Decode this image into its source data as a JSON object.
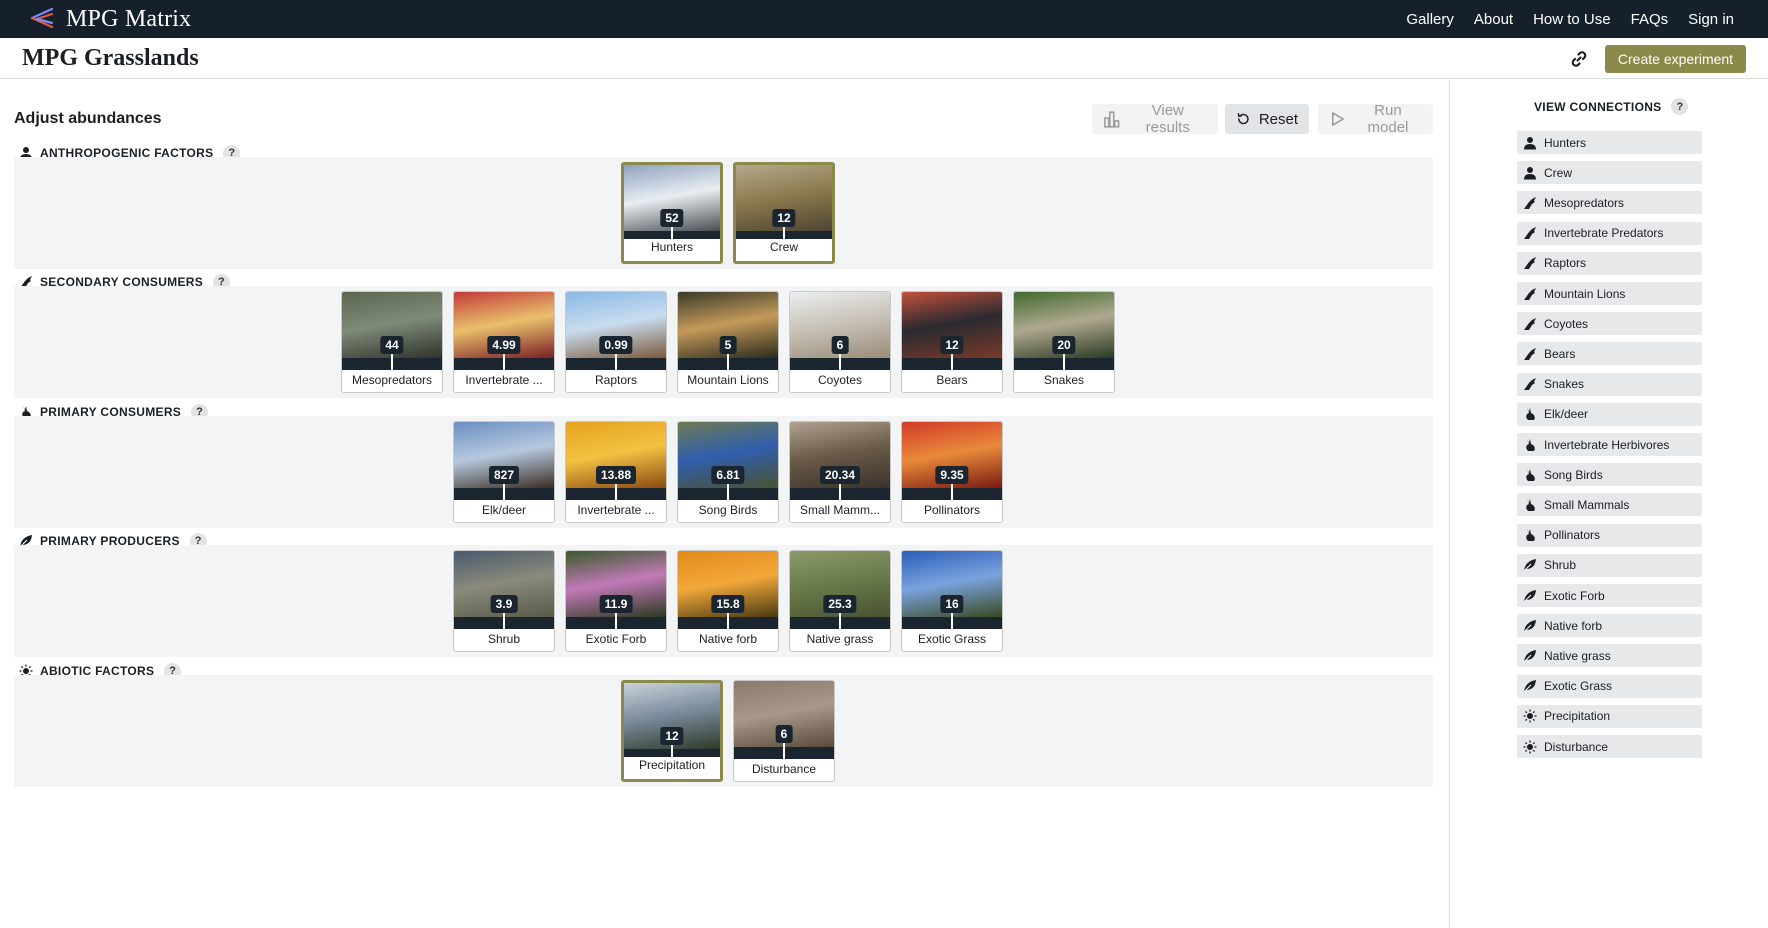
{
  "app": {
    "brand": "MPG Matrix",
    "nav": [
      "Gallery",
      "About",
      "How to Use",
      "FAQs",
      "Sign in"
    ]
  },
  "header": {
    "title": "MPG Grasslands",
    "create_label": "Create experiment",
    "accent": "#8c8a4a"
  },
  "main": {
    "title": "Adjust abundances",
    "buttons": {
      "view_results": "View results",
      "reset": "Reset",
      "run_model": "Run model"
    },
    "sections": [
      {
        "title": "ANTHROPOGENIC FACTORS",
        "icon": "person-icon",
        "tiles": [
          {
            "label": "Hunters",
            "value": "52",
            "selected": true,
            "photo": [
              "#8fa3bf",
              "#e9edf2",
              "#4a4e53"
            ]
          },
          {
            "label": "Crew",
            "value": "12",
            "selected": true,
            "photo": [
              "#b4a98c",
              "#8c7a4e",
              "#4e4433"
            ]
          }
        ]
      },
      {
        "title": "SECONDARY CONSUMERS",
        "icon": "predator-icon",
        "tiles": [
          {
            "label": "Mesopredators",
            "value": "44",
            "selected": false,
            "photo": [
              "#5c6650",
              "#7f8a78",
              "#2e332a"
            ]
          },
          {
            "label": "Invertebrate ...",
            "value": "4.99",
            "selected": false,
            "photo": [
              "#c23a3a",
              "#e9c06b",
              "#7a1e27"
            ]
          },
          {
            "label": "Raptors",
            "value": "0.99",
            "selected": false,
            "photo": [
              "#8ab8e6",
              "#c9dcef",
              "#7a5a3a"
            ]
          },
          {
            "label": "Mountain Lions",
            "value": "5",
            "selected": false,
            "photo": [
              "#3a3a2a",
              "#c49a5a",
              "#2a2a1e"
            ]
          },
          {
            "label": "Coyotes",
            "value": "6",
            "selected": false,
            "photo": [
              "#eceef0",
              "#c8c2b8",
              "#9a8c78"
            ]
          },
          {
            "label": "Bears",
            "value": "12",
            "selected": false,
            "photo": [
              "#c2503a",
              "#2a2a30",
              "#7a3a2a"
            ]
          },
          {
            "label": "Snakes",
            "value": "20",
            "selected": false,
            "photo": [
              "#3f6a2e",
              "#b0a890",
              "#2a3a22"
            ]
          }
        ]
      },
      {
        "title": "PRIMARY CONSUMERS",
        "icon": "rabbit-icon",
        "tiles": [
          {
            "label": "Elk/deer",
            "value": "827",
            "selected": false,
            "photo": [
              "#6c8fc2",
              "#b6c8de",
              "#3a2e22"
            ]
          },
          {
            "label": "Invertebrate ...",
            "value": "13.88",
            "selected": false,
            "photo": [
              "#e6a21e",
              "#f2c243",
              "#8a4a12"
            ]
          },
          {
            "label": "Song Birds",
            "value": "6.81",
            "selected": false,
            "photo": [
              "#6f7a52",
              "#2f5fae",
              "#4a5232"
            ]
          },
          {
            "label": "Small Mamm...",
            "value": "20.34",
            "selected": false,
            "photo": [
              "#b0a292",
              "#6a5a48",
              "#3a322a"
            ]
          },
          {
            "label": "Pollinators",
            "value": "9.35",
            "selected": false,
            "photo": [
              "#d23a2a",
              "#e88a3a",
              "#7a1a14"
            ]
          }
        ]
      },
      {
        "title": "PRIMARY PRODUCERS",
        "icon": "leaf-icon",
        "tiles": [
          {
            "label": "Shrub",
            "value": "3.9",
            "selected": false,
            "photo": [
              "#4a5a6e",
              "#8a8a7a",
              "#5a5a4a"
            ]
          },
          {
            "label": "Exotic Forb",
            "value": "11.9",
            "selected": false,
            "photo": [
              "#3a5a2a",
              "#c27ab8",
              "#2a3a1e"
            ]
          },
          {
            "label": "Native forb",
            "value": "15.8",
            "selected": false,
            "photo": [
              "#e28a1a",
              "#f2a83a",
              "#4a3a12"
            ]
          },
          {
            "label": "Native grass",
            "value": "25.3",
            "selected": false,
            "photo": [
              "#8a9a6a",
              "#6a7a4a",
              "#4a5232"
            ]
          },
          {
            "label": "Exotic Grass",
            "value": "16",
            "selected": false,
            "photo": [
              "#2a5fb8",
              "#7aa2de",
              "#3a4a22"
            ]
          }
        ]
      },
      {
        "title": "ABIOTIC FACTORS",
        "icon": "sun-icon",
        "tiles": [
          {
            "label": "Precipitation",
            "value": "12",
            "selected": true,
            "photo": [
              "#c8d2dc",
              "#7a8a9a",
              "#2e3a2a"
            ]
          },
          {
            "label": "Disturbance",
            "value": "6",
            "selected": false,
            "photo": [
              "#8a7a6a",
              "#a8988a",
              "#5a4a3a"
            ]
          }
        ]
      }
    ]
  },
  "sidebar": {
    "title": "VIEW CONNECTIONS",
    "items": [
      {
        "label": "Hunters",
        "icon": "person-icon"
      },
      {
        "label": "Crew",
        "icon": "person-icon"
      },
      {
        "label": "Mesopredators",
        "icon": "predator-icon"
      },
      {
        "label": "Invertebrate Predators",
        "icon": "predator-icon"
      },
      {
        "label": "Raptors",
        "icon": "predator-icon"
      },
      {
        "label": "Mountain Lions",
        "icon": "predator-icon"
      },
      {
        "label": "Coyotes",
        "icon": "predator-icon"
      },
      {
        "label": "Bears",
        "icon": "predator-icon"
      },
      {
        "label": "Snakes",
        "icon": "predator-icon"
      },
      {
        "label": "Elk/deer",
        "icon": "rabbit-icon"
      },
      {
        "label": "Invertebrate Herbivores",
        "icon": "rabbit-icon"
      },
      {
        "label": "Song Birds",
        "icon": "rabbit-icon"
      },
      {
        "label": "Small Mammals",
        "icon": "rabbit-icon"
      },
      {
        "label": "Pollinators",
        "icon": "rabbit-icon"
      },
      {
        "label": "Shrub",
        "icon": "leaf-icon"
      },
      {
        "label": "Exotic Forb",
        "icon": "leaf-icon"
      },
      {
        "label": "Native forb",
        "icon": "leaf-icon"
      },
      {
        "label": "Native grass",
        "icon": "leaf-icon"
      },
      {
        "label": "Exotic Grass",
        "icon": "leaf-icon"
      },
      {
        "label": "Precipitation",
        "icon": "sun-icon"
      },
      {
        "label": "Disturbance",
        "icon": "sun-icon"
      }
    ]
  }
}
